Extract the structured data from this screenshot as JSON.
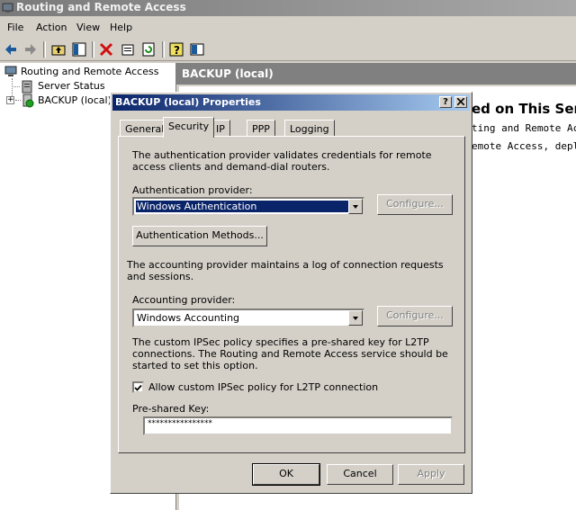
{
  "app": {
    "title": "Routing and Remote Access"
  },
  "menu": [
    "File",
    "Action",
    "View",
    "Help"
  ],
  "toolbar_icons": [
    "back-icon",
    "forward-icon",
    "up-folder-icon",
    "show-hide-tree-icon",
    "delete-icon",
    "properties-icon",
    "refresh-icon",
    "help-icon",
    "console-icon"
  ],
  "tree": {
    "root": "Routing and Remote Access",
    "items": [
      "Server Status",
      "BACKUP (local)"
    ]
  },
  "right": {
    "header": "BACKUP (local)",
    "title": "ed on This Serv",
    "lines": [
      "ting and Remote Ac",
      "emote Access, deplo"
    ]
  },
  "dialog": {
    "title": "BACKUP (local) Properties",
    "tabs": [
      "General",
      "Security",
      "IP",
      "PPP",
      "Logging"
    ],
    "active_tab": "Security",
    "auth_desc": "The authentication provider validates credentials for remote access clients and demand-dial routers.",
    "auth_label": "Authentication provider:",
    "auth_value": "Windows Authentication",
    "configure": "Configure...",
    "auth_methods": "Authentication Methods...",
    "acct_desc": "The accounting provider maintains a log of connection requests and sessions.",
    "acct_label": "Accounting provider:",
    "acct_value": "Windows Accounting",
    "ipsec_desc": "The custom IPSec policy specifies a pre-shared key for L2TP connections. The Routing and Remote Access service should be started to set this option.",
    "ipsec_checkbox": "Allow custom IPSec policy for L2TP connection",
    "ipsec_checked": true,
    "psk_label": "Pre-shared Key:",
    "psk_value": "****************",
    "ok": "OK",
    "cancel": "Cancel",
    "apply": "Apply"
  }
}
